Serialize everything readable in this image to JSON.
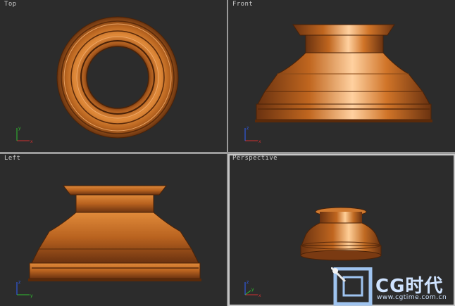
{
  "viewports": {
    "top": {
      "label": "Top"
    },
    "front": {
      "label": "Front"
    },
    "left": {
      "label": "Left"
    },
    "perspective": {
      "label": "Perspective"
    }
  },
  "axis": {
    "x": "x",
    "y": "y",
    "z": "z"
  },
  "watermark": {
    "brand": "CG时代",
    "url": "www.cgtime.com.cn"
  },
  "colors": {
    "viewport_bg": "#2c2c2c",
    "model": "#c8732a",
    "axis_x": "#d03030",
    "axis_y": "#30c030",
    "axis_z": "#3060ff"
  }
}
